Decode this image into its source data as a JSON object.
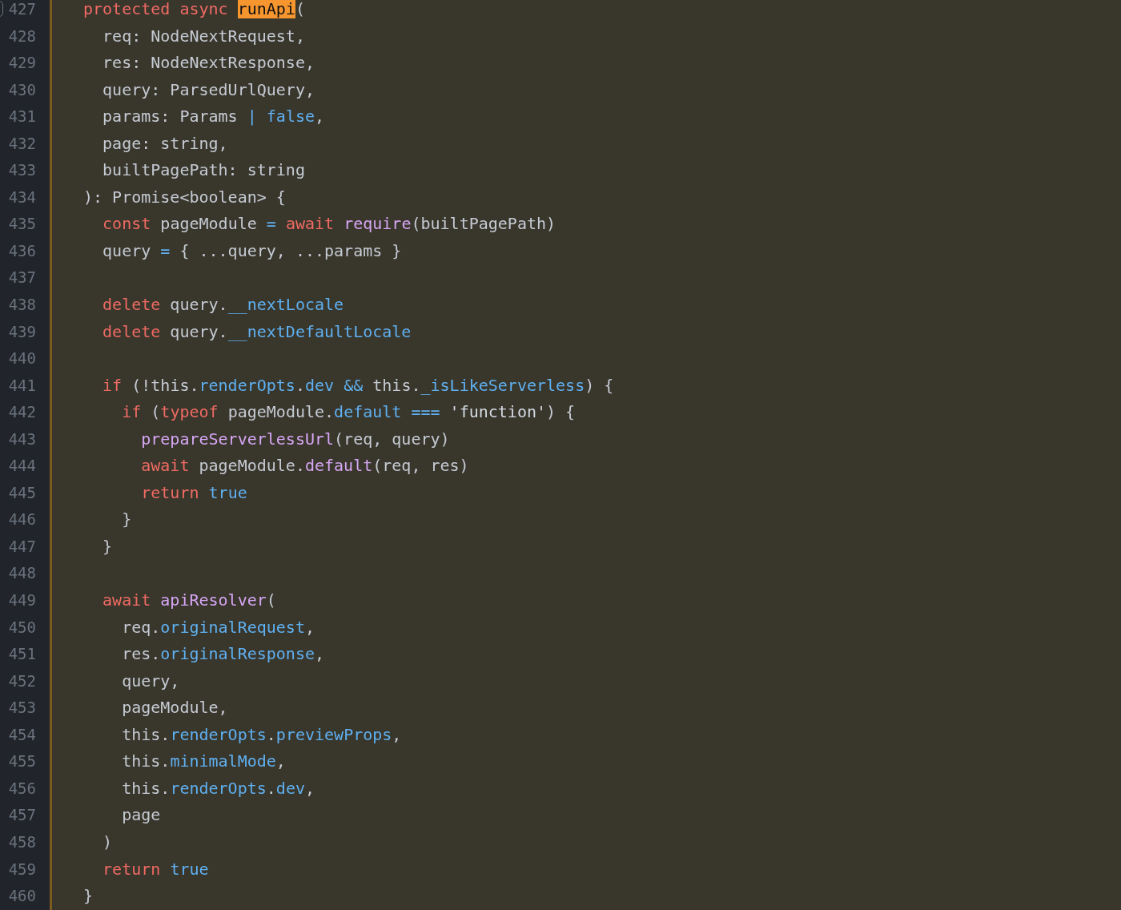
{
  "editor": {
    "lines": [
      {
        "number": "427",
        "marker": true,
        "tokens": [
          {
            "kind": "keyword",
            "text": "protected async "
          },
          {
            "kind": "match",
            "text": "runApi"
          },
          {
            "kind": "plain",
            "text": "("
          }
        ]
      },
      {
        "number": "428",
        "tokens": [
          {
            "kind": "plain",
            "text": "  req: NodeNextRequest,"
          }
        ]
      },
      {
        "number": "429",
        "tokens": [
          {
            "kind": "plain",
            "text": "  res: NodeNextResponse,"
          }
        ]
      },
      {
        "number": "430",
        "tokens": [
          {
            "kind": "plain",
            "text": "  query: ParsedUrlQuery,"
          }
        ]
      },
      {
        "number": "431",
        "tokens": [
          {
            "kind": "plain",
            "text": "  params: Params "
          },
          {
            "kind": "operator",
            "text": "| "
          },
          {
            "kind": "constant",
            "text": "false"
          },
          {
            "kind": "plain",
            "text": ","
          }
        ]
      },
      {
        "number": "432",
        "tokens": [
          {
            "kind": "plain",
            "text": "  page: string,"
          }
        ]
      },
      {
        "number": "433",
        "tokens": [
          {
            "kind": "plain",
            "text": "  builtPagePath: string"
          }
        ]
      },
      {
        "number": "434",
        "tokens": [
          {
            "kind": "plain",
            "text": "): Promise<boolean> {"
          }
        ]
      },
      {
        "number": "435",
        "tokens": [
          {
            "kind": "keyword",
            "text": "  const"
          },
          {
            "kind": "plain",
            "text": " pageModule "
          },
          {
            "kind": "operator",
            "text": "= "
          },
          {
            "kind": "keyword",
            "text": "await "
          },
          {
            "kind": "function",
            "text": "require"
          },
          {
            "kind": "plain",
            "text": "(builtPagePath)"
          }
        ]
      },
      {
        "number": "436",
        "tokens": [
          {
            "kind": "plain",
            "text": "  query "
          },
          {
            "kind": "operator",
            "text": "="
          },
          {
            "kind": "plain",
            "text": " { ...query, ...params }"
          }
        ]
      },
      {
        "number": "437"
      },
      {
        "number": "438",
        "tokens": [
          {
            "kind": "keyword",
            "text": "  delete"
          },
          {
            "kind": "plain",
            "text": " query."
          },
          {
            "kind": "property",
            "text": "__nextLocale"
          }
        ]
      },
      {
        "number": "439",
        "tokens": [
          {
            "kind": "keyword",
            "text": "  delete"
          },
          {
            "kind": "plain",
            "text": " query."
          },
          {
            "kind": "property",
            "text": "__nextDefaultLocale"
          }
        ]
      },
      {
        "number": "440"
      },
      {
        "number": "441",
        "tokens": [
          {
            "kind": "keyword",
            "text": "  if"
          },
          {
            "kind": "plain",
            "text": " (!this."
          },
          {
            "kind": "property",
            "text": "renderOpts"
          },
          {
            "kind": "plain",
            "text": "."
          },
          {
            "kind": "property",
            "text": "dev "
          },
          {
            "kind": "operator",
            "text": "&&"
          },
          {
            "kind": "plain",
            "text": " this."
          },
          {
            "kind": "property",
            "text": "_isLikeServerless"
          },
          {
            "kind": "plain",
            "text": ") {"
          }
        ]
      },
      {
        "number": "442",
        "tokens": [
          {
            "kind": "keyword",
            "text": "    if"
          },
          {
            "kind": "plain",
            "text": " ("
          },
          {
            "kind": "keyword",
            "text": "typeof"
          },
          {
            "kind": "plain",
            "text": " pageModule."
          },
          {
            "kind": "property",
            "text": "default "
          },
          {
            "kind": "operator",
            "text": "=== "
          },
          {
            "kind": "string",
            "text": "'function'"
          },
          {
            "kind": "plain",
            "text": ") {"
          }
        ]
      },
      {
        "number": "443",
        "tokens": [
          {
            "kind": "function",
            "text": "      prepareServerlessUrl"
          },
          {
            "kind": "plain",
            "text": "(req, query)"
          }
        ]
      },
      {
        "number": "444",
        "tokens": [
          {
            "kind": "keyword",
            "text": "      await"
          },
          {
            "kind": "plain",
            "text": " pageModule."
          },
          {
            "kind": "function",
            "text": "default"
          },
          {
            "kind": "plain",
            "text": "(req, res)"
          }
        ]
      },
      {
        "number": "445",
        "tokens": [
          {
            "kind": "keyword",
            "text": "      return "
          },
          {
            "kind": "constant",
            "text": "true"
          }
        ]
      },
      {
        "number": "446",
        "tokens": [
          {
            "kind": "plain",
            "text": "    }"
          }
        ]
      },
      {
        "number": "447",
        "tokens": [
          {
            "kind": "plain",
            "text": "  }"
          }
        ]
      },
      {
        "number": "448"
      },
      {
        "number": "449",
        "tokens": [
          {
            "kind": "keyword",
            "text": "  await "
          },
          {
            "kind": "function",
            "text": "apiResolver"
          },
          {
            "kind": "plain",
            "text": "("
          }
        ]
      },
      {
        "number": "450",
        "tokens": [
          {
            "kind": "plain",
            "text": "    req."
          },
          {
            "kind": "property",
            "text": "originalRequest"
          },
          {
            "kind": "plain",
            "text": ","
          }
        ]
      },
      {
        "number": "451",
        "tokens": [
          {
            "kind": "plain",
            "text": "    res."
          },
          {
            "kind": "property",
            "text": "originalResponse"
          },
          {
            "kind": "plain",
            "text": ","
          }
        ]
      },
      {
        "number": "452",
        "tokens": [
          {
            "kind": "plain",
            "text": "    query,"
          }
        ]
      },
      {
        "number": "453",
        "tokens": [
          {
            "kind": "plain",
            "text": "    pageModule,"
          }
        ]
      },
      {
        "number": "454",
        "tokens": [
          {
            "kind": "plain",
            "text": "    this."
          },
          {
            "kind": "property",
            "text": "renderOpts"
          },
          {
            "kind": "plain",
            "text": "."
          },
          {
            "kind": "property",
            "text": "previewProps"
          },
          {
            "kind": "plain",
            "text": ","
          }
        ]
      },
      {
        "number": "455",
        "tokens": [
          {
            "kind": "plain",
            "text": "    this."
          },
          {
            "kind": "property",
            "text": "minimalMode"
          },
          {
            "kind": "plain",
            "text": ","
          }
        ]
      },
      {
        "number": "456",
        "tokens": [
          {
            "kind": "plain",
            "text": "    this."
          },
          {
            "kind": "property",
            "text": "renderOpts"
          },
          {
            "kind": "plain",
            "text": "."
          },
          {
            "kind": "property",
            "text": "dev"
          },
          {
            "kind": "plain",
            "text": ","
          }
        ]
      },
      {
        "number": "457",
        "tokens": [
          {
            "kind": "plain",
            "text": "    page"
          }
        ]
      },
      {
        "number": "458",
        "tokens": [
          {
            "kind": "plain",
            "text": "  )"
          }
        ]
      },
      {
        "number": "459",
        "tokens": [
          {
            "kind": "keyword",
            "text": "  return "
          },
          {
            "kind": "constant",
            "text": "true"
          }
        ]
      },
      {
        "number": "460",
        "tokens": [
          {
            "kind": "plain",
            "text": "}"
          }
        ]
      }
    ]
  }
}
